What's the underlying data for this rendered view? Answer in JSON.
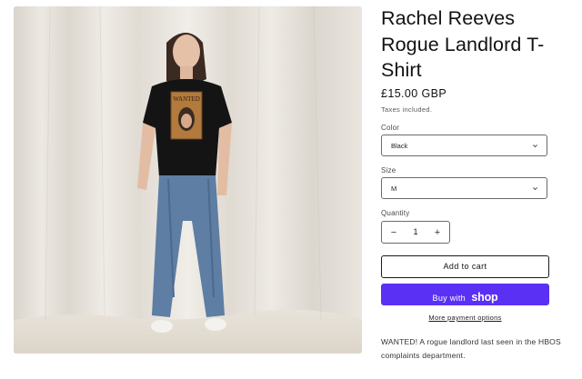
{
  "product": {
    "title": "Rachel Reeves Rogue Landlord T-Shirt",
    "image_alt": "Model wearing black t-shirt with WANTED poster print",
    "print_text": "WANTED",
    "price": "£15.00 GBP",
    "tax_note": "Taxes included.",
    "description": "WANTED! A rogue landlord last seen in the HBOS complaints department."
  },
  "options": {
    "color": {
      "label": "Color",
      "selected": "Black"
    },
    "size": {
      "label": "Size",
      "selected": "M"
    },
    "quantity": {
      "label": "Quantity",
      "value": "1",
      "minus": "−",
      "plus": "+"
    }
  },
  "actions": {
    "add_to_cart": "Add to cart",
    "buy_with": "Buy with",
    "shop_logo": "shop",
    "more_payment": "More payment options"
  },
  "colors": {
    "shop_pay": "#5a31f4",
    "border": "#6a6a6a"
  },
  "icons": {
    "select_chevron": "chevron-down-icon"
  }
}
